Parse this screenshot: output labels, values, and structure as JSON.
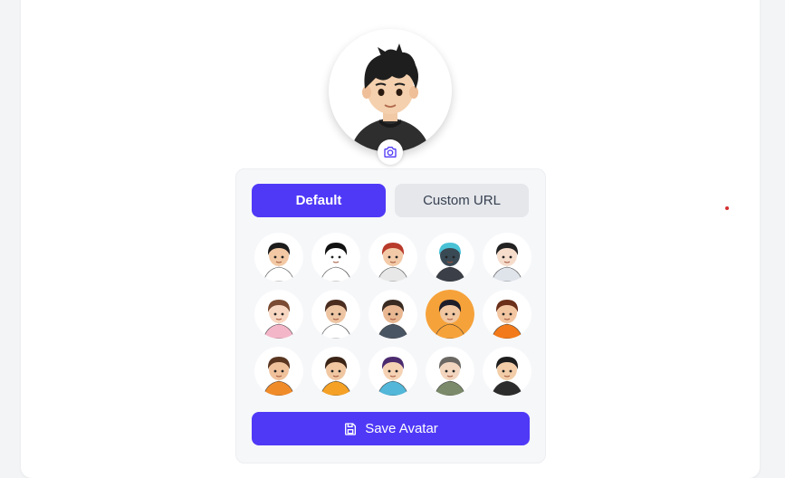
{
  "profile": {
    "current_avatar": "avatar-black-hair-boy",
    "camera_icon": "camera-icon"
  },
  "tabs": [
    {
      "label": "Default",
      "active": true
    },
    {
      "label": "Custom URL",
      "active": false
    }
  ],
  "avatars": [
    {
      "id": "avatar-sunglasses-guy",
      "skin": "#f2c9a4",
      "hair": "#1c1c1c",
      "shirt": "#ffffff",
      "bg": "#ffffff"
    },
    {
      "id": "avatar-monokuma-bear",
      "skin": "#ffffff",
      "hair": "#111111",
      "shirt": "#ffffff",
      "bg": "#ffffff"
    },
    {
      "id": "avatar-headband-boy",
      "skin": "#f3caa8",
      "hair": "#b83a2a",
      "shirt": "#e8e8e8",
      "bg": "#ffffff"
    },
    {
      "id": "avatar-blue-flame-hero",
      "skin": "#3a4a55",
      "hair": "#49c2d6",
      "shirt": "#3a3f48",
      "bg": "#ffffff"
    },
    {
      "id": "avatar-long-hair-girl",
      "skin": "#f6dccb",
      "hair": "#222222",
      "shirt": "#dfe3ea",
      "bg": "#ffffff"
    },
    {
      "id": "avatar-bob-cut-girl",
      "skin": "#f8d7c2",
      "hair": "#7a4a32",
      "shirt": "#f3b6c8",
      "bg": "#ffffff"
    },
    {
      "id": "avatar-suit-guy",
      "skin": "#eec5a3",
      "hair": "#4a2d1f",
      "shirt": "#ffffff",
      "bg": "#ffffff"
    },
    {
      "id": "avatar-beanie-girl",
      "skin": "#e9b892",
      "hair": "#3a2b22",
      "shirt": "#4a5563",
      "bg": "#ffffff"
    },
    {
      "id": "avatar-orange-bg-girl",
      "skin": "#f1c7a2",
      "hair": "#1e1e2a",
      "shirt": "#f6a23a",
      "bg": "#f6a23a"
    },
    {
      "id": "avatar-orange-hoodie-girl",
      "skin": "#f3c6a2",
      "hair": "#6b2f1a",
      "shirt": "#f27a1a",
      "bg": "#ffffff"
    },
    {
      "id": "avatar-curly-hair-girl",
      "skin": "#f0c29c",
      "hair": "#5a3621",
      "shirt": "#f08b2a",
      "bg": "#ffffff"
    },
    {
      "id": "avatar-glasses-boy",
      "skin": "#f1c7a2",
      "hair": "#3b2416",
      "shirt": "#f4a126",
      "bg": "#ffffff"
    },
    {
      "id": "avatar-purple-hair-boy",
      "skin": "#f6d2b4",
      "hair": "#4b2b6e",
      "shirt": "#52b7d8",
      "bg": "#ffffff"
    },
    {
      "id": "avatar-scarf-boy",
      "skin": "#f3d6bf",
      "hair": "#6b6763",
      "shirt": "#7b8a6a",
      "bg": "#ffffff"
    },
    {
      "id": "avatar-dark-hoodie-boy",
      "skin": "#f2cda8",
      "hair": "#1e1e1e",
      "shirt": "#2c2c2c",
      "bg": "#ffffff"
    }
  ],
  "save_button": {
    "label": "Save Avatar",
    "icon": "save-icon"
  },
  "colors": {
    "accent": "#4f39f6",
    "inactive_tab": "#e5e7eb",
    "panel_bg": "#f6f7f9"
  }
}
